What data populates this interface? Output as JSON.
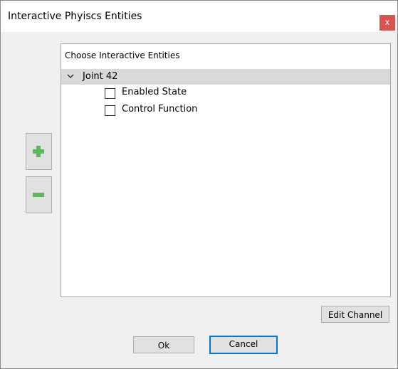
{
  "dialog": {
    "title": "Interactive Phyiscs Entities",
    "close_label": "x"
  },
  "panel": {
    "header": "Choose Interactive Entities",
    "tree": {
      "node_label": "Joint 42",
      "expanded": true,
      "children": [
        {
          "label": "Enabled State",
          "checked": false
        },
        {
          "label": "Control Function",
          "checked": false
        }
      ]
    }
  },
  "side_buttons": {
    "add_icon": "plus-icon",
    "remove_icon": "minus-icon"
  },
  "buttons": {
    "edit_channel": "Edit Channel",
    "ok": "Ok",
    "cancel": "Cancel"
  },
  "colors": {
    "close_button": "#d9534f",
    "icon_green": "#5cb85c",
    "primary_border": "#0078d7",
    "selected_row": "#d9d9d9"
  }
}
